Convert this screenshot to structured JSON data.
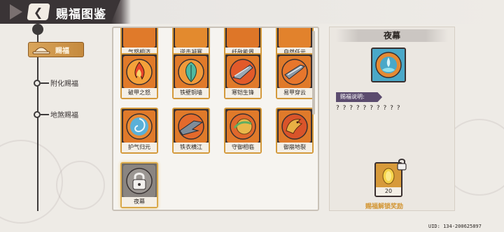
{
  "header": {
    "title": "赐福图鉴",
    "back_icon": "back-chevron-icon"
  },
  "nav": {
    "active": {
      "label": "赐福",
      "icon": "hat-icon"
    },
    "items": [
      {
        "label": "附化赐福"
      },
      {
        "label": "地煞赐福"
      }
    ]
  },
  "grid": {
    "rows": [
      {
        "labels": [
          "气怒相济",
          "逆击凝寒",
          "纤敌能周",
          "自然任元"
        ],
        "partial": true
      },
      {
        "labels": [
          "破甲之怒",
          "铁壁铜墙",
          "寒铠生锋",
          "易甲穿云"
        ]
      },
      {
        "labels": [
          "护气归元",
          "铁衣横江",
          "守御相临",
          "御崩地裂"
        ]
      },
      {
        "labels": [
          "夜幕"
        ]
      }
    ],
    "locked_card": {
      "label": "夜幕",
      "icon": "lock-icon"
    }
  },
  "detail": {
    "title": "夜幕",
    "desc_label": "赐福说明:",
    "desc_text": "? ? ? ? ? ? ? ? ? ?",
    "reward": {
      "count": "20",
      "label": "赐福解锁奖励",
      "icon": "gold-coin-icon",
      "lock_icon": "lock-icon"
    }
  },
  "uid": "UID: 134-200625897",
  "colors": {
    "accent": "#d49a3c",
    "header_dark": "#3a3436",
    "desc_tag": "#5b4b6e",
    "reward_label": "#d39634"
  }
}
